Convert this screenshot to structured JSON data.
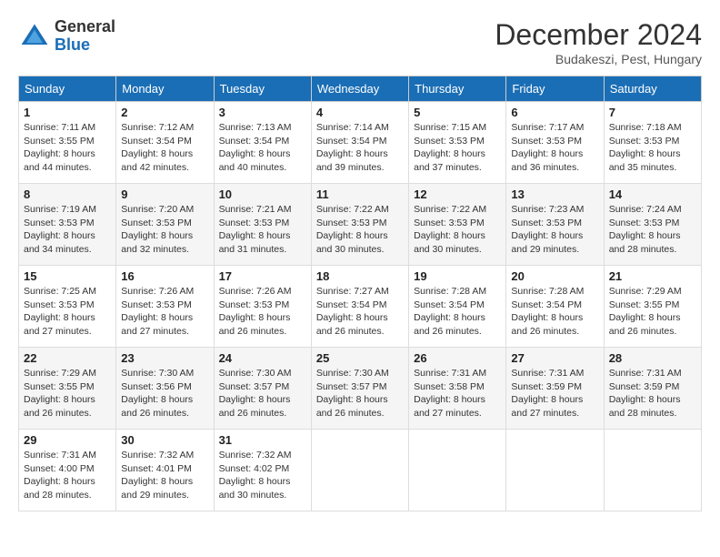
{
  "logo": {
    "general": "General",
    "blue": "Blue"
  },
  "title": "December 2024",
  "subtitle": "Budakeszi, Pest, Hungary",
  "days_of_week": [
    "Sunday",
    "Monday",
    "Tuesday",
    "Wednesday",
    "Thursday",
    "Friday",
    "Saturday"
  ],
  "weeks": [
    [
      {
        "day": "1",
        "sunrise": "7:11 AM",
        "sunset": "3:55 PM",
        "daylight": "8 hours and 44 minutes."
      },
      {
        "day": "2",
        "sunrise": "7:12 AM",
        "sunset": "3:54 PM",
        "daylight": "8 hours and 42 minutes."
      },
      {
        "day": "3",
        "sunrise": "7:13 AM",
        "sunset": "3:54 PM",
        "daylight": "8 hours and 40 minutes."
      },
      {
        "day": "4",
        "sunrise": "7:14 AM",
        "sunset": "3:54 PM",
        "daylight": "8 hours and 39 minutes."
      },
      {
        "day": "5",
        "sunrise": "7:15 AM",
        "sunset": "3:53 PM",
        "daylight": "8 hours and 37 minutes."
      },
      {
        "day": "6",
        "sunrise": "7:17 AM",
        "sunset": "3:53 PM",
        "daylight": "8 hours and 36 minutes."
      },
      {
        "day": "7",
        "sunrise": "7:18 AM",
        "sunset": "3:53 PM",
        "daylight": "8 hours and 35 minutes."
      }
    ],
    [
      {
        "day": "8",
        "sunrise": "7:19 AM",
        "sunset": "3:53 PM",
        "daylight": "8 hours and 34 minutes."
      },
      {
        "day": "9",
        "sunrise": "7:20 AM",
        "sunset": "3:53 PM",
        "daylight": "8 hours and 32 minutes."
      },
      {
        "day": "10",
        "sunrise": "7:21 AM",
        "sunset": "3:53 PM",
        "daylight": "8 hours and 31 minutes."
      },
      {
        "day": "11",
        "sunrise": "7:22 AM",
        "sunset": "3:53 PM",
        "daylight": "8 hours and 30 minutes."
      },
      {
        "day": "12",
        "sunrise": "7:22 AM",
        "sunset": "3:53 PM",
        "daylight": "8 hours and 30 minutes."
      },
      {
        "day": "13",
        "sunrise": "7:23 AM",
        "sunset": "3:53 PM",
        "daylight": "8 hours and 29 minutes."
      },
      {
        "day": "14",
        "sunrise": "7:24 AM",
        "sunset": "3:53 PM",
        "daylight": "8 hours and 28 minutes."
      }
    ],
    [
      {
        "day": "15",
        "sunrise": "7:25 AM",
        "sunset": "3:53 PM",
        "daylight": "8 hours and 27 minutes."
      },
      {
        "day": "16",
        "sunrise": "7:26 AM",
        "sunset": "3:53 PM",
        "daylight": "8 hours and 27 minutes."
      },
      {
        "day": "17",
        "sunrise": "7:26 AM",
        "sunset": "3:53 PM",
        "daylight": "8 hours and 26 minutes."
      },
      {
        "day": "18",
        "sunrise": "7:27 AM",
        "sunset": "3:54 PM",
        "daylight": "8 hours and 26 minutes."
      },
      {
        "day": "19",
        "sunrise": "7:28 AM",
        "sunset": "3:54 PM",
        "daylight": "8 hours and 26 minutes."
      },
      {
        "day": "20",
        "sunrise": "7:28 AM",
        "sunset": "3:54 PM",
        "daylight": "8 hours and 26 minutes."
      },
      {
        "day": "21",
        "sunrise": "7:29 AM",
        "sunset": "3:55 PM",
        "daylight": "8 hours and 26 minutes."
      }
    ],
    [
      {
        "day": "22",
        "sunrise": "7:29 AM",
        "sunset": "3:55 PM",
        "daylight": "8 hours and 26 minutes."
      },
      {
        "day": "23",
        "sunrise": "7:30 AM",
        "sunset": "3:56 PM",
        "daylight": "8 hours and 26 minutes."
      },
      {
        "day": "24",
        "sunrise": "7:30 AM",
        "sunset": "3:57 PM",
        "daylight": "8 hours and 26 minutes."
      },
      {
        "day": "25",
        "sunrise": "7:30 AM",
        "sunset": "3:57 PM",
        "daylight": "8 hours and 26 minutes."
      },
      {
        "day": "26",
        "sunrise": "7:31 AM",
        "sunset": "3:58 PM",
        "daylight": "8 hours and 27 minutes."
      },
      {
        "day": "27",
        "sunrise": "7:31 AM",
        "sunset": "3:59 PM",
        "daylight": "8 hours and 27 minutes."
      },
      {
        "day": "28",
        "sunrise": "7:31 AM",
        "sunset": "3:59 PM",
        "daylight": "8 hours and 28 minutes."
      }
    ],
    [
      {
        "day": "29",
        "sunrise": "7:31 AM",
        "sunset": "4:00 PM",
        "daylight": "8 hours and 28 minutes."
      },
      {
        "day": "30",
        "sunrise": "7:32 AM",
        "sunset": "4:01 PM",
        "daylight": "8 hours and 29 minutes."
      },
      {
        "day": "31",
        "sunrise": "7:32 AM",
        "sunset": "4:02 PM",
        "daylight": "8 hours and 30 minutes."
      },
      null,
      null,
      null,
      null
    ]
  ]
}
